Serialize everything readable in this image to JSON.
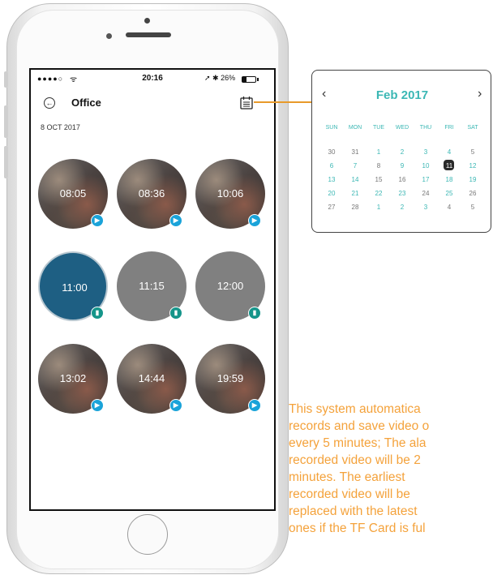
{
  "status_bar": {
    "signal": "●●●●○",
    "wifi": "ᯤ",
    "time": "20:16",
    "right": "➚ ✱ 26%"
  },
  "nav": {
    "title": "Office",
    "back_icon": "back-arrow-icon",
    "calendar_icon": "calendar-icon"
  },
  "date_label": "8 OCT 2017",
  "recordings": [
    {
      "time": "08:05",
      "kind": "video"
    },
    {
      "time": "08:36",
      "kind": "video"
    },
    {
      "time": "10:06",
      "kind": "video"
    },
    {
      "time": "11:00",
      "kind": "active"
    },
    {
      "time": "11:15",
      "kind": "photo"
    },
    {
      "time": "12:00",
      "kind": "photo"
    },
    {
      "time": "13:02",
      "kind": "video"
    },
    {
      "time": "14:44",
      "kind": "video"
    },
    {
      "time": "19:59",
      "kind": "video"
    }
  ],
  "calendar": {
    "month_label": "Feb 2017",
    "prev": "‹",
    "next": "›",
    "weekdays": [
      "SUN",
      "MON",
      "TUE",
      "WED",
      "THU",
      "FRI",
      "SAT"
    ],
    "weeks": [
      [
        "30",
        "31",
        "1",
        "2",
        "3",
        "4",
        "5"
      ],
      [
        "6",
        "7",
        "8",
        "9",
        "10",
        "11",
        "12"
      ],
      [
        "13",
        "14",
        "15",
        "16",
        "17",
        "18",
        "19"
      ],
      [
        "20",
        "21",
        "22",
        "23",
        "24",
        "25",
        "26"
      ],
      [
        "27",
        "28",
        "1",
        "2",
        "3",
        "4",
        "5"
      ]
    ],
    "selected": "11",
    "accent": "#3bb7b4"
  },
  "description_lines": [
    "This system automatica",
    "records and save video o",
    "every 5 minutes; The ala",
    "recorded video will be 2",
    "minutes. The earliest",
    "recorded video will be",
    "replaced with the latest",
    "ones if the TF Card is ful"
  ],
  "colors": {
    "orange": "#f4a23b",
    "teal": "#3bb7b4",
    "video_badge": "#1aa3d9",
    "photo_badge": "#15958a"
  }
}
